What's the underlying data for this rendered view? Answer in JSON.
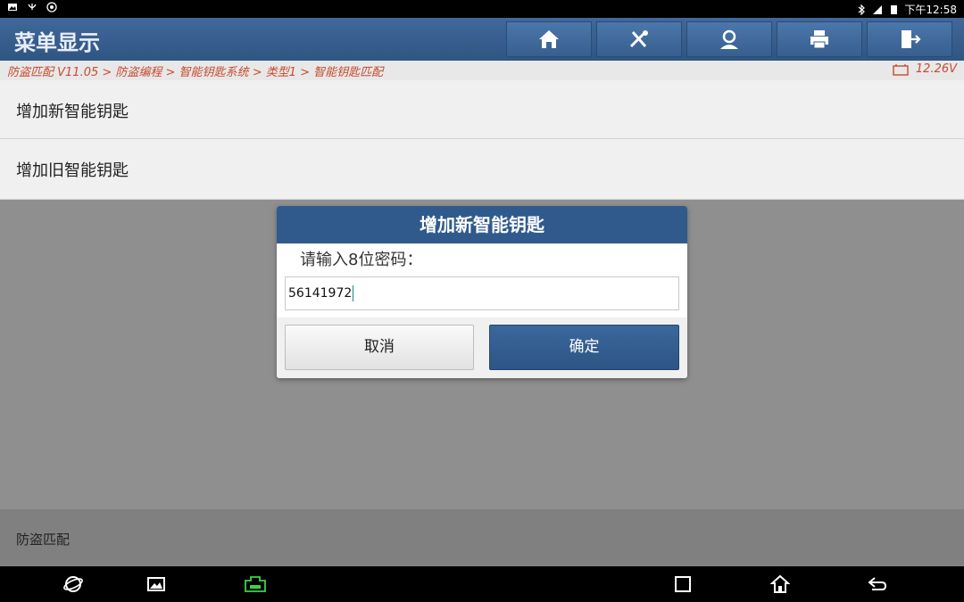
{
  "status_bar": {
    "left_icons": [
      "image-icon",
      "usb-debug-icon",
      "no-disturb-icon"
    ],
    "right_icons": [
      "bluetooth-icon",
      "signal-icon",
      "battery-icon"
    ],
    "time": "下午12:58"
  },
  "header": {
    "title": "菜单显示",
    "toolbar": [
      "home-icon",
      "diagnostic-tools-icon",
      "user-icon",
      "print-icon",
      "exit-icon"
    ]
  },
  "breadcrumb": {
    "path": "防盗匹配 V11.05 > 防盗编程 > 智能钥匙系统 > 类型1 > 智能钥匙匹配",
    "voltage": "12.26V"
  },
  "menu": {
    "items": [
      {
        "label": "增加新智能钥匙"
      },
      {
        "label": "增加旧智能钥匙"
      }
    ]
  },
  "footer": {
    "label": "防盗匹配"
  },
  "dialog": {
    "title": "增加新智能钥匙",
    "prompt": "请输入8位密码：",
    "input_value": "56141972",
    "cancel_label": "取消",
    "confirm_label": "确定"
  },
  "navbar": {
    "icons": [
      "browser-icon",
      "gallery-icon",
      "vci-icon",
      "recents-icon",
      "home-icon",
      "back-icon"
    ]
  },
  "colors": {
    "header": "#3a5f89",
    "breadcrumb_text": "#c74a2f",
    "dialog_title": "#305a8c",
    "confirm_button": "#2d5585"
  }
}
